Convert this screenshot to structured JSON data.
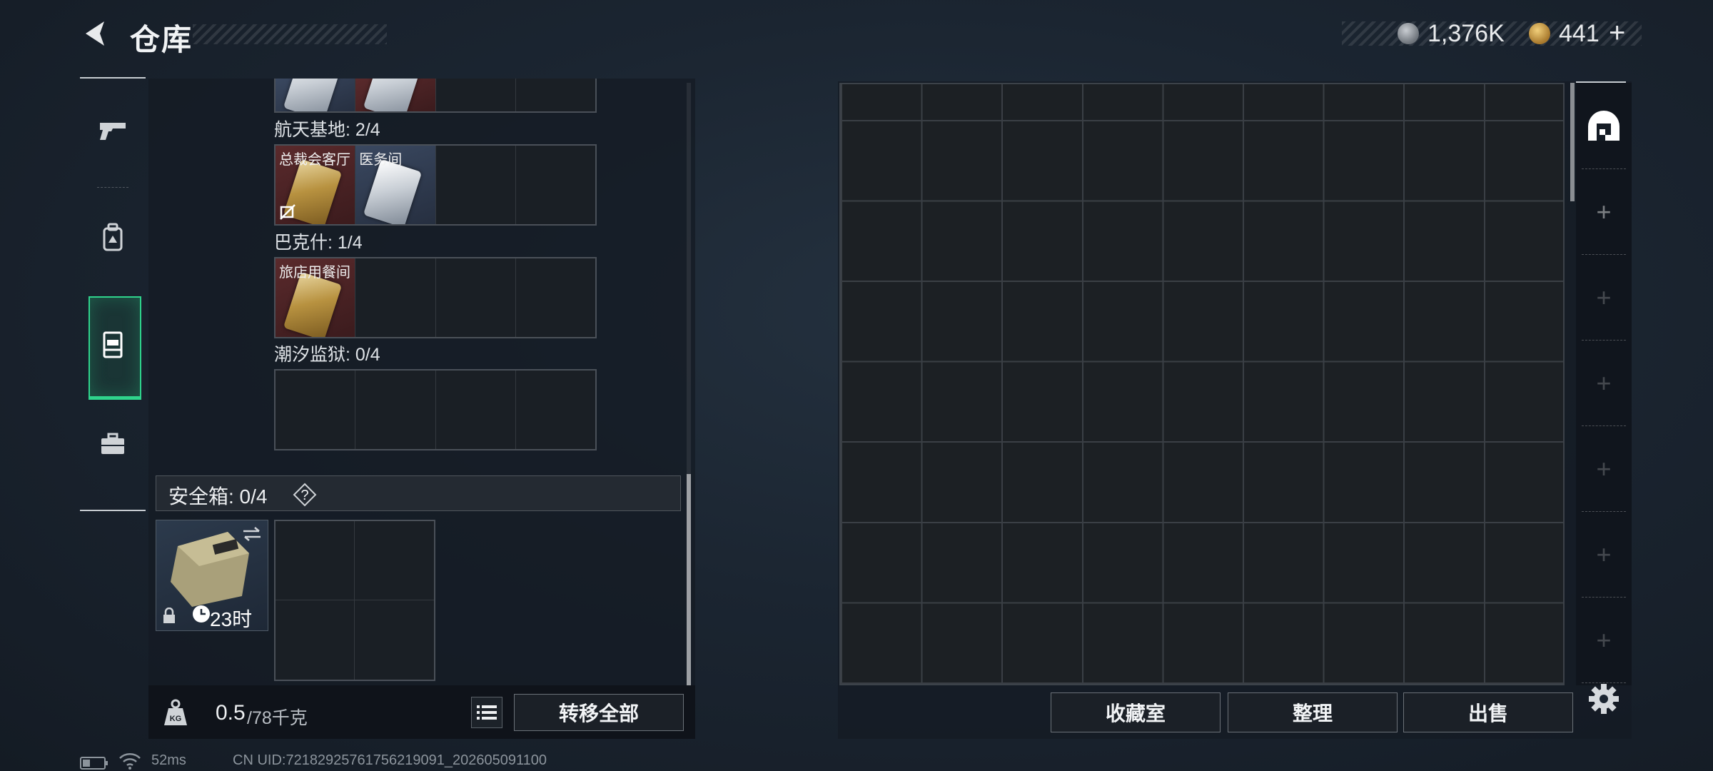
{
  "header": {
    "title": "仓库",
    "currency": [
      {
        "name": "silver-coin",
        "value": "1,376K"
      },
      {
        "name": "gold-coin",
        "value": "441"
      }
    ],
    "plus_label": "+"
  },
  "nav": {
    "items": [
      {
        "icon": "pistol-icon",
        "active": false
      },
      {
        "icon": "backpack-icon",
        "active": false
      },
      {
        "icon": "case-icon",
        "active": true
      },
      {
        "icon": "toolbox-icon",
        "active": false
      }
    ]
  },
  "keycards": {
    "sections": [
      {
        "label": "航天基地: 2/4",
        "cells": [
          {
            "label": "总裁会客厅",
            "style": "red",
            "card": "gold",
            "disabled": true
          },
          {
            "label": "医务间",
            "style": "blue",
            "card": "silver",
            "disabled": false
          },
          {
            "label": "",
            "style": "",
            "card": "",
            "disabled": false
          },
          {
            "label": "",
            "style": "",
            "card": "",
            "disabled": false
          }
        ]
      },
      {
        "label": "巴克什: 1/4",
        "cells": [
          {
            "label": "旅店用餐间",
            "style": "red",
            "card": "gold",
            "disabled": false
          },
          {
            "label": "",
            "style": "",
            "card": "",
            "disabled": false
          },
          {
            "label": "",
            "style": "",
            "card": "",
            "disabled": false
          },
          {
            "label": "",
            "style": "",
            "card": "",
            "disabled": false
          }
        ]
      },
      {
        "label": "潮汐监狱: 0/4",
        "cells": [
          {
            "label": "",
            "style": "",
            "card": "",
            "disabled": false
          },
          {
            "label": "",
            "style": "",
            "card": "",
            "disabled": false
          },
          {
            "label": "",
            "style": "",
            "card": "",
            "disabled": false
          },
          {
            "label": "",
            "style": "",
            "card": "",
            "disabled": false
          }
        ]
      }
    ]
  },
  "safe": {
    "label": "安全箱: 0/4",
    "help": "?",
    "timer": "23时"
  },
  "footer_left": {
    "weight_value": "0.5",
    "weight_max": "/78千克",
    "transfer_label": "转移全部"
  },
  "footer_right": {
    "buttons": [
      "收藏室",
      "整理",
      "出售"
    ]
  },
  "status": {
    "ping": "52ms",
    "uid": "CN UID:72182925761756219091_202605091100"
  },
  "colors": {
    "accent_green": "#2fd48c",
    "panel_bg": "#141b24"
  }
}
